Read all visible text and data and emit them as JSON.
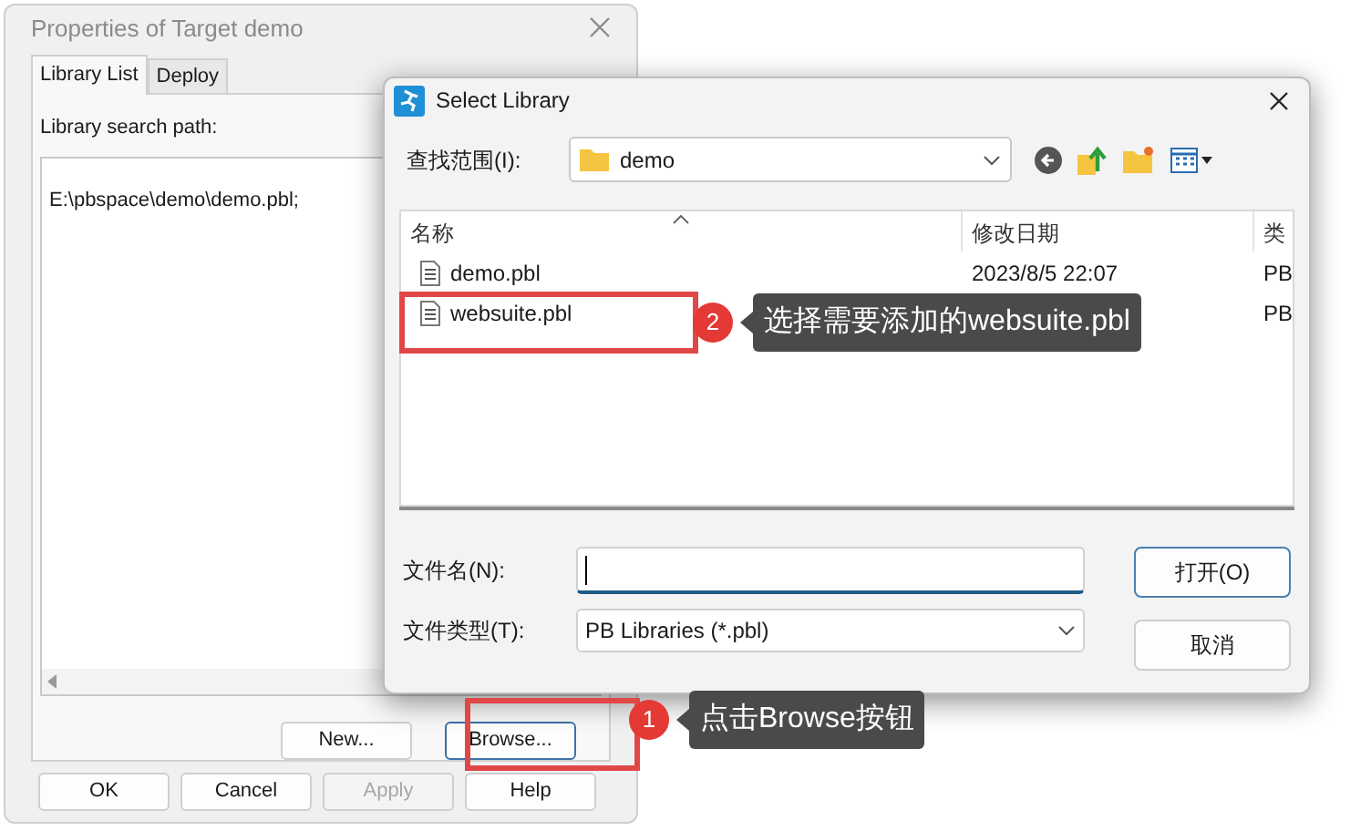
{
  "properties_window": {
    "title": "Properties of Target demo",
    "tabs": [
      {
        "label": "Library List",
        "selected": true
      },
      {
        "label": "Deploy",
        "selected": false
      }
    ],
    "search_path_label": "Library search path:",
    "search_path": "E:\\pbspace\\demo\\demo.pbl;",
    "list_buttons": [
      {
        "label": "New..."
      },
      {
        "label": "Browse..."
      }
    ],
    "buttons": [
      {
        "label": "OK",
        "disabled": false
      },
      {
        "label": "Cancel",
        "disabled": false
      },
      {
        "label": "Apply",
        "disabled": true
      },
      {
        "label": "Help",
        "disabled": false
      }
    ]
  },
  "select_dialog": {
    "title": "Select Library",
    "look_in": {
      "label": "查找范围(I):",
      "value": "demo"
    },
    "columns": [
      "名称",
      "修改日期",
      "类"
    ],
    "files": [
      {
        "name": "demo.pbl",
        "modified": "2023/8/5 22:07",
        "type": "PB"
      },
      {
        "name": "websuite.pbl",
        "type": "PB"
      }
    ],
    "file_name": {
      "label": "文件名(N):"
    },
    "file_type": {
      "label": "文件类型(T):",
      "value": "PB Libraries (*.pbl)"
    },
    "buttons": [
      "打开(O)",
      "取消"
    ]
  },
  "annotations": [
    {
      "number": "2",
      "text": "选择需要添加的websuite.pbl"
    },
    {
      "number": "1",
      "text": "点击Browse按钮"
    }
  ]
}
